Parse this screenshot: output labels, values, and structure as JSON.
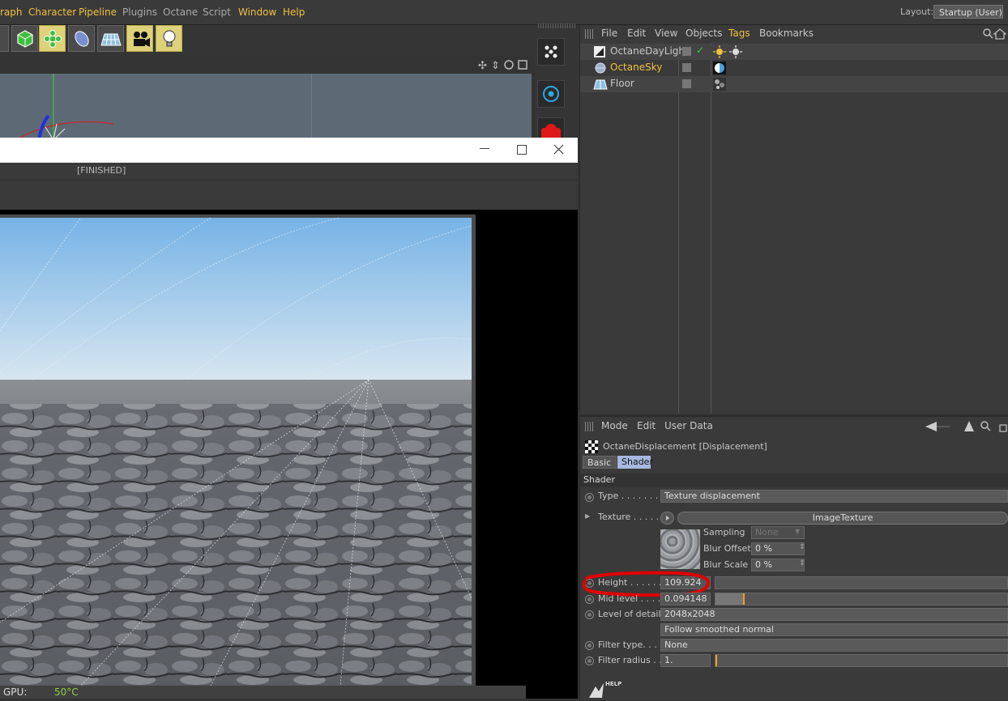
{
  "menubar": {
    "items": [
      "raph",
      "Character",
      "Pipeline",
      "Plugins",
      "Octane",
      "Script",
      "Window",
      "Help"
    ],
    "layout_label": "Layout:",
    "layout_value": "Startup (User)"
  },
  "render_window": {
    "status": "[FINISHED]",
    "gpu_label": "GPU:",
    "gpu_temp": "50°C"
  },
  "object_manager": {
    "menu": [
      "File",
      "Edit",
      "View",
      "Objects",
      "Tags",
      "Bookmarks"
    ],
    "objects": [
      {
        "name": "OctaneDayLight",
        "color": "#d0d0d0"
      },
      {
        "name": "OctaneSky",
        "color": "#f0c040"
      },
      {
        "name": "Floor",
        "color": "#d0d0d0"
      }
    ]
  },
  "attribute_manager": {
    "menu": [
      "Mode",
      "Edit",
      "User Data"
    ],
    "title": "OctaneDisplacement [Displacement]",
    "tabs": [
      "Basic",
      "Shader"
    ],
    "section": "Shader",
    "type_label": "Type . . . . . . . .",
    "type_value": "Texture displacement",
    "texture_label": "Texture . . . . . .",
    "texture_value": "ImageTexture",
    "sampling_label": "Sampling",
    "sampling_value": "None",
    "blur_offset_label": "Blur Offset",
    "blur_offset_value": "0 %",
    "blur_scale_label": "Blur Scale",
    "blur_scale_value": "0 %",
    "height_label": "Height . . . . . .",
    "height_value": "109.924",
    "height_slider_fraction": 0.0,
    "mid_level_label": "Mid level . . . .",
    "mid_level_value": "0.094148",
    "mid_level_slider_fraction": 0.094148,
    "lod_label": "Level of detail",
    "lod_value": "2048x2048",
    "smooth_value": "Follow smoothed normal",
    "filter_type_label": "Filter type. . . .",
    "filter_type_value": "None",
    "filter_radius_label": "Filter radius . .",
    "filter_radius_value": "1.",
    "filter_radius_slider_fraction": 0.0,
    "help_text": "HELP"
  },
  "colors": {
    "accent_yellow": "#f0c040",
    "highlight_red": "#e00000",
    "tab_active": "#a7b8e0"
  }
}
